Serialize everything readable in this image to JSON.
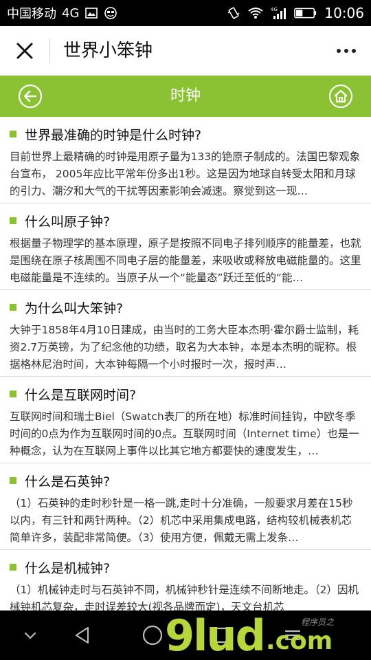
{
  "status_bar": {
    "carrier": "中国移动",
    "network": "4G",
    "time": "10:06",
    "signal_label": "4G"
  },
  "title_bar": {
    "title": "世界小笨钟"
  },
  "header": {
    "title": "时钟",
    "accent_color": "#8ac234"
  },
  "articles": [
    {
      "title": "世界最准确的时钟是什么时钟?",
      "body": "目前世界上最精确的时钟是用原子量为133的铯原子制成的。法国巴黎观象台宣布， 2005年应比平常年份多出1秒。这是因为地球自转受太阳和月球的引力、潮汐和大气的干扰等因素影响会减速。察觉到这一现…"
    },
    {
      "title": "什么叫原子钟?",
      "body": "根据量子物理学的基本原理，原子是按照不同电子排列顺序的能量差，也就是围绕在原子核周围不同电子层的能量差，来吸收或释放电磁能量的。这里电磁能量是不连续的。当原子从一个“能量态”跃迁至低的“能…"
    },
    {
      "title": "为什么叫大笨钟?",
      "body": "大钟于1858年4月10日建成，由当时的工务大臣本杰明·霍尔爵士监制，耗资2.7万英镑，为了纪念他的功绩，取名为大本钟，本是本杰明的昵称。根据格林尼治时间，大本钟每隔一个小时报时一次，报时声…"
    },
    {
      "title": "什么是互联网时间?",
      "body": "互联网时间和瑞士Biel（Swatch表厂的所在地）标准时间挂钩，中欧冬季时间的0点为作为互联网时间的0点。互联网时间（Internet time）也是一种概念，认为在互联网上事件以比其它地方都要快的速度发生，…"
    },
    {
      "title": "什么是石英钟?",
      "body": "（1）石英钟的走时秒针是一格一跳,走时十分准确，一般要求月差在15秒以内，有三针和两针两种。（2）机芯中采用集成电路，结构较机械表机芯简单许多，装配非常简便。（3）使用方便，佩戴无需上发条…"
    },
    {
      "title": "什么是机械钟?",
      "body": "（1）机械钟走时与石英钟不同，机械钟秒针是连续不间断地走。（2）因机械钟机芯复杂，走时误差较大(视各品牌而定)，天文台机芯"
    }
  ],
  "watermark": {
    "brand": "9lud",
    "suffix": ".com",
    "cn_text": "程序员之"
  }
}
